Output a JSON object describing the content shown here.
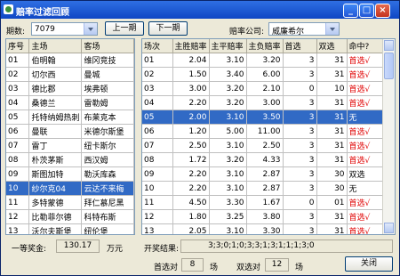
{
  "window": {
    "title": "赔率过滤回顾",
    "min_symbol": "_",
    "max_symbol": "□",
    "close_symbol": "×"
  },
  "toolbar": {
    "period_label": "期数:",
    "period_value": "7079",
    "prev_label": "上一期",
    "next_label": "下一期",
    "company_label": "赔率公司:",
    "company_value": "威廉希尔"
  },
  "matches": {
    "columns": [
      "序号",
      "主场",
      "客场"
    ],
    "rows": [
      [
        "01",
        "伯明翰",
        "维冈竞技"
      ],
      [
        "02",
        "切尔西",
        "曼城"
      ],
      [
        "03",
        "德比郡",
        "埃弗顿"
      ],
      [
        "04",
        "桑德兰",
        "雷勒姆"
      ],
      [
        "05",
        "托特纳姆热刺",
        "布莱克本"
      ],
      [
        "06",
        "曼联",
        "米德尔斯堡"
      ],
      [
        "07",
        "雷丁",
        "纽卡斯尔"
      ],
      [
        "08",
        "朴茨茅斯",
        "西汉姆"
      ],
      [
        "09",
        "斯图加特",
        "勒沃库森"
      ],
      [
        "10",
        "纱尔克04",
        "云达不来梅"
      ],
      [
        "11",
        "多特蒙德",
        "拜仁慕尼黑"
      ],
      [
        "12",
        "比勒菲尔德",
        "科特布斯"
      ],
      [
        "13",
        "沃尔夫斯堡",
        "纽伦堡"
      ],
      [
        "14",
        "杜伊斯堡",
        "汉堡"
      ]
    ],
    "selected_index": 9
  },
  "odds": {
    "columns": [
      "场次",
      "主胜赔率",
      "主平赔率",
      "主负赔率",
      "首选",
      "双选",
      "命中?"
    ],
    "rows": [
      [
        "01",
        "2.04",
        "3.10",
        "3.20",
        "3",
        "31",
        "首选√"
      ],
      [
        "02",
        "1.50",
        "3.40",
        "6.00",
        "3",
        "31",
        "首选√"
      ],
      [
        "03",
        "3.00",
        "3.20",
        "2.10",
        "0",
        "10",
        "首选√"
      ],
      [
        "04",
        "2.20",
        "3.20",
        "3.00",
        "3",
        "31",
        "首选√"
      ],
      [
        "05",
        "2.00",
        "3.10",
        "3.50",
        "3",
        "31",
        "无"
      ],
      [
        "06",
        "1.20",
        "5.00",
        "11.00",
        "3",
        "31",
        "首选√"
      ],
      [
        "07",
        "2.50",
        "3.10",
        "2.50",
        "3",
        "31",
        "首选√"
      ],
      [
        "08",
        "1.72",
        "3.20",
        "4.33",
        "3",
        "31",
        "首选√"
      ],
      [
        "09",
        "2.20",
        "3.10",
        "2.87",
        "3",
        "30",
        "双选"
      ],
      [
        "10",
        "2.20",
        "3.10",
        "2.87",
        "3",
        "30",
        "无"
      ],
      [
        "11",
        "4.50",
        "3.30",
        "1.67",
        "0",
        "01",
        "首选√"
      ],
      [
        "12",
        "1.80",
        "3.25",
        "3.80",
        "3",
        "31",
        "首选√"
      ],
      [
        "13",
        "2.05",
        "3.10",
        "3.30",
        "3",
        "31",
        "首选√"
      ],
      [
        "14",
        "3.50",
        "3.20",
        "1.91",
        "0",
        "01",
        "首选√"
      ]
    ],
    "selected_index": 4,
    "highlight_color": "#e00000"
  },
  "footer": {
    "prize_label": "一等奖金:",
    "prize_value": "130.17",
    "prize_unit": "万元",
    "result_label": "开奖结果:",
    "result_value": "3;3;0;1;0;3;3;1;3;1;1;1;3;0",
    "first_correct_label": "首选对",
    "first_correct_value": "8",
    "first_unit": "场",
    "double_correct_label": "双选对",
    "double_correct_value": "12",
    "double_unit": "场",
    "close_label": "关闭"
  },
  "colors": {
    "selection": "#316ac5",
    "titlebar": "#0f46c4"
  }
}
